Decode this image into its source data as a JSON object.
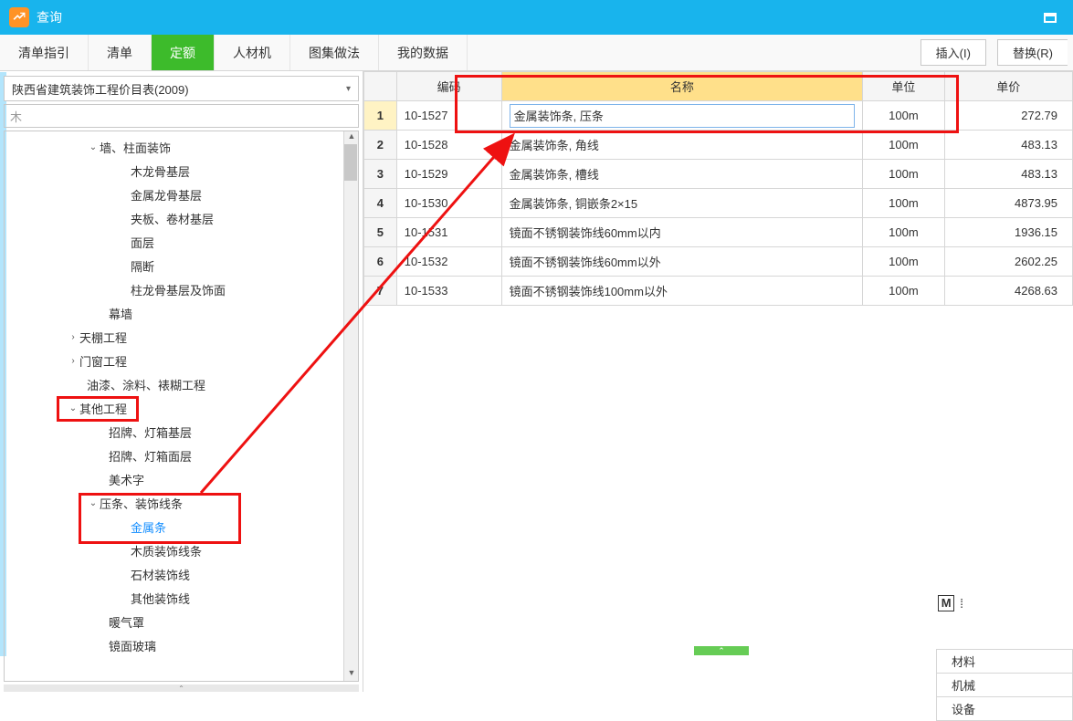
{
  "titlebar": {
    "title": "查询"
  },
  "tabs": {
    "guide": "清单指引",
    "list": "清单",
    "quota": "定额",
    "res": "人材机",
    "atlas": "图集做法",
    "mydata": "我的数据"
  },
  "buttons": {
    "insert": "插入(I)",
    "replace": "替换(R)"
  },
  "dropdown": {
    "text": "陕西省建筑装饰工程价目表(2009)"
  },
  "search": {
    "value": "木"
  },
  "tree": {
    "n_wall": "墙、柱面装饰",
    "n_wood": "木龙骨基层",
    "n_metal": "金属龙骨基层",
    "n_board": "夹板、卷材基层",
    "n_surface": "面层",
    "n_partition": "隔断",
    "n_pillar": "柱龙骨基层及饰面",
    "n_curtain": "幕墙",
    "n_ceiling": "天棚工程",
    "n_door": "门窗工程",
    "n_paint": "油漆、涂料、裱糊工程",
    "n_other": "其他工程",
    "n_sign1": "招牌、灯箱基层",
    "n_sign2": "招牌、灯箱面层",
    "n_art": "美术字",
    "n_strip": "压条、装饰线条",
    "n_gold": "金属条",
    "n_woodstrip": "木质装饰线条",
    "n_stone": "石材装饰线",
    "n_otherstrip": "其他装饰线",
    "n_heat": "暖气罩",
    "n_mirror": "镜面玻璃"
  },
  "grid": {
    "h_code": "编码",
    "h_name": "名称",
    "h_unit": "单位",
    "h_price": "单价",
    "rows": [
      {
        "n": "1",
        "code": "10-1527",
        "name": "金属装饰条, 压条",
        "unit": "100m",
        "price": "272.79"
      },
      {
        "n": "2",
        "code": "10-1528",
        "name": "金属装饰条, 角线",
        "unit": "100m",
        "price": "483.13"
      },
      {
        "n": "3",
        "code": "10-1529",
        "name": "金属装饰条, 槽线",
        "unit": "100m",
        "price": "483.13"
      },
      {
        "n": "4",
        "code": "10-1530",
        "name": "金属装饰条, 铜嵌条2×15",
        "unit": "100m",
        "price": "4873.95"
      },
      {
        "n": "5",
        "code": "10-1531",
        "name": "镜面不锈钢装饰线60mm以内",
        "unit": "100m",
        "price": "1936.15"
      },
      {
        "n": "6",
        "code": "10-1532",
        "name": "镜面不锈钢装饰线60mm以外",
        "unit": "100m",
        "price": "2602.25"
      },
      {
        "n": "7",
        "code": "10-1533",
        "name": "镜面不锈钢装饰线100mm以外",
        "unit": "100m",
        "price": "4268.63"
      }
    ]
  },
  "bottom": {
    "mat": "材料",
    "mach": "机械",
    "equip": "设备"
  },
  "m_ind": "M"
}
